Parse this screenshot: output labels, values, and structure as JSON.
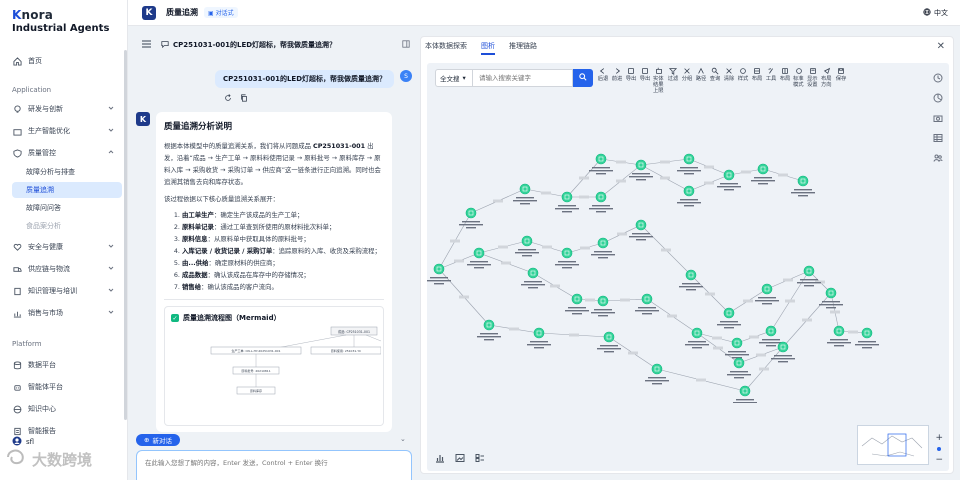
{
  "brand": {
    "line1_k": "K",
    "line1_rest": "nora",
    "line2": "Industrial Agents"
  },
  "header": {
    "title": "质量追溯",
    "tag": "对话式",
    "lang": "中文"
  },
  "sidebar": {
    "home": "首页",
    "section_app": "Application",
    "items": [
      "研发与创新",
      "生产智能优化",
      "质量管控"
    ],
    "quality_sub": [
      "故障分析与排查",
      "质量追溯",
      "故障问问答",
      "食品案分析"
    ],
    "items2": [
      "安全与健康",
      "供应链与物流",
      "知识管理与培训",
      "销售与市场"
    ],
    "section_platform": "Platform",
    "platform_items": [
      "数据平台",
      "智能体平台",
      "知识中心",
      "智能报告"
    ],
    "user": "sfl"
  },
  "chat": {
    "title": "CP251031-001的LED灯超标，帮我做质量追溯？",
    "user_message": "CP251031-001的LED灯超标，帮我做质量追溯？",
    "user_avatar": "S",
    "bot_avatar": "K",
    "answer_title": "质量追溯分析说明",
    "para_1": "根据本体模型中的质量追溯关系，我们将从问题成品 ",
    "para_bold": "CP251031-001",
    "para_2": " 出发，沿着“成品 → 生产工单 → 原料料使用记录 → 原料批号 → 原料库存 → 原料入库 → 采购收货 → 采购订单 → 供应商”这一链条进行正向追溯。同时也会追溯其销售去向和库存状态。",
    "lead": "该过程依据以下核心质量追溯关系展开：",
    "list": [
      {
        "b": "由工单生产",
        "t": "：确定生产该成品的生产工单；"
      },
      {
        "b": "原料单记录",
        "t": "：通过工单查到所使用的原材料批次料单；"
      },
      {
        "b": "原料信息",
        "t": "：从原料单中获取具体的原料批号；"
      },
      {
        "b": "入库记录 / 收货记录 / 采购订单",
        "t": "：追踪原料的入库、收货及采购流程；"
      },
      {
        "b": "由...供给",
        "t": "：确定原材料的供应商；"
      },
      {
        "b": "成品数据",
        "t": "：确认该成品在库存中的存储情况；"
      },
      {
        "b": "销售给",
        "t": "：确认该成品的客户流向。"
      }
    ],
    "flow_title": "质量追溯流程图（Mermaid）",
    "flow_nodes": [
      "成品: CP251031-001",
      "生产工单: CN-L-HY-20251031-001",
      "原料使用: 251031-YC",
      "原料批号: 20210811",
      "原料库存"
    ],
    "new_chat": "新对话",
    "input_placeholder": "在此输入您想了解的内容，Enter 发送，Control + Enter 换行"
  },
  "graph": {
    "tabs": [
      "本体数据探索",
      "图析",
      "推理链路"
    ],
    "active_tab": 1,
    "select_value": "全文搜",
    "search_placeholder": "请输入搜索关键字",
    "tools": [
      "后退",
      "前进",
      "导出",
      "导出",
      "实体结果上限",
      "过滤",
      "分组",
      "路径",
      "查询",
      "清除",
      "样式",
      "布局",
      "工具",
      "布局",
      "标准模式",
      "显示设置",
      "布局方向",
      "保存"
    ]
  },
  "watermark": "大数跨境",
  "colors": {
    "accent": "#2563eb",
    "node": "#34d399",
    "edge": "#9ca3af"
  }
}
